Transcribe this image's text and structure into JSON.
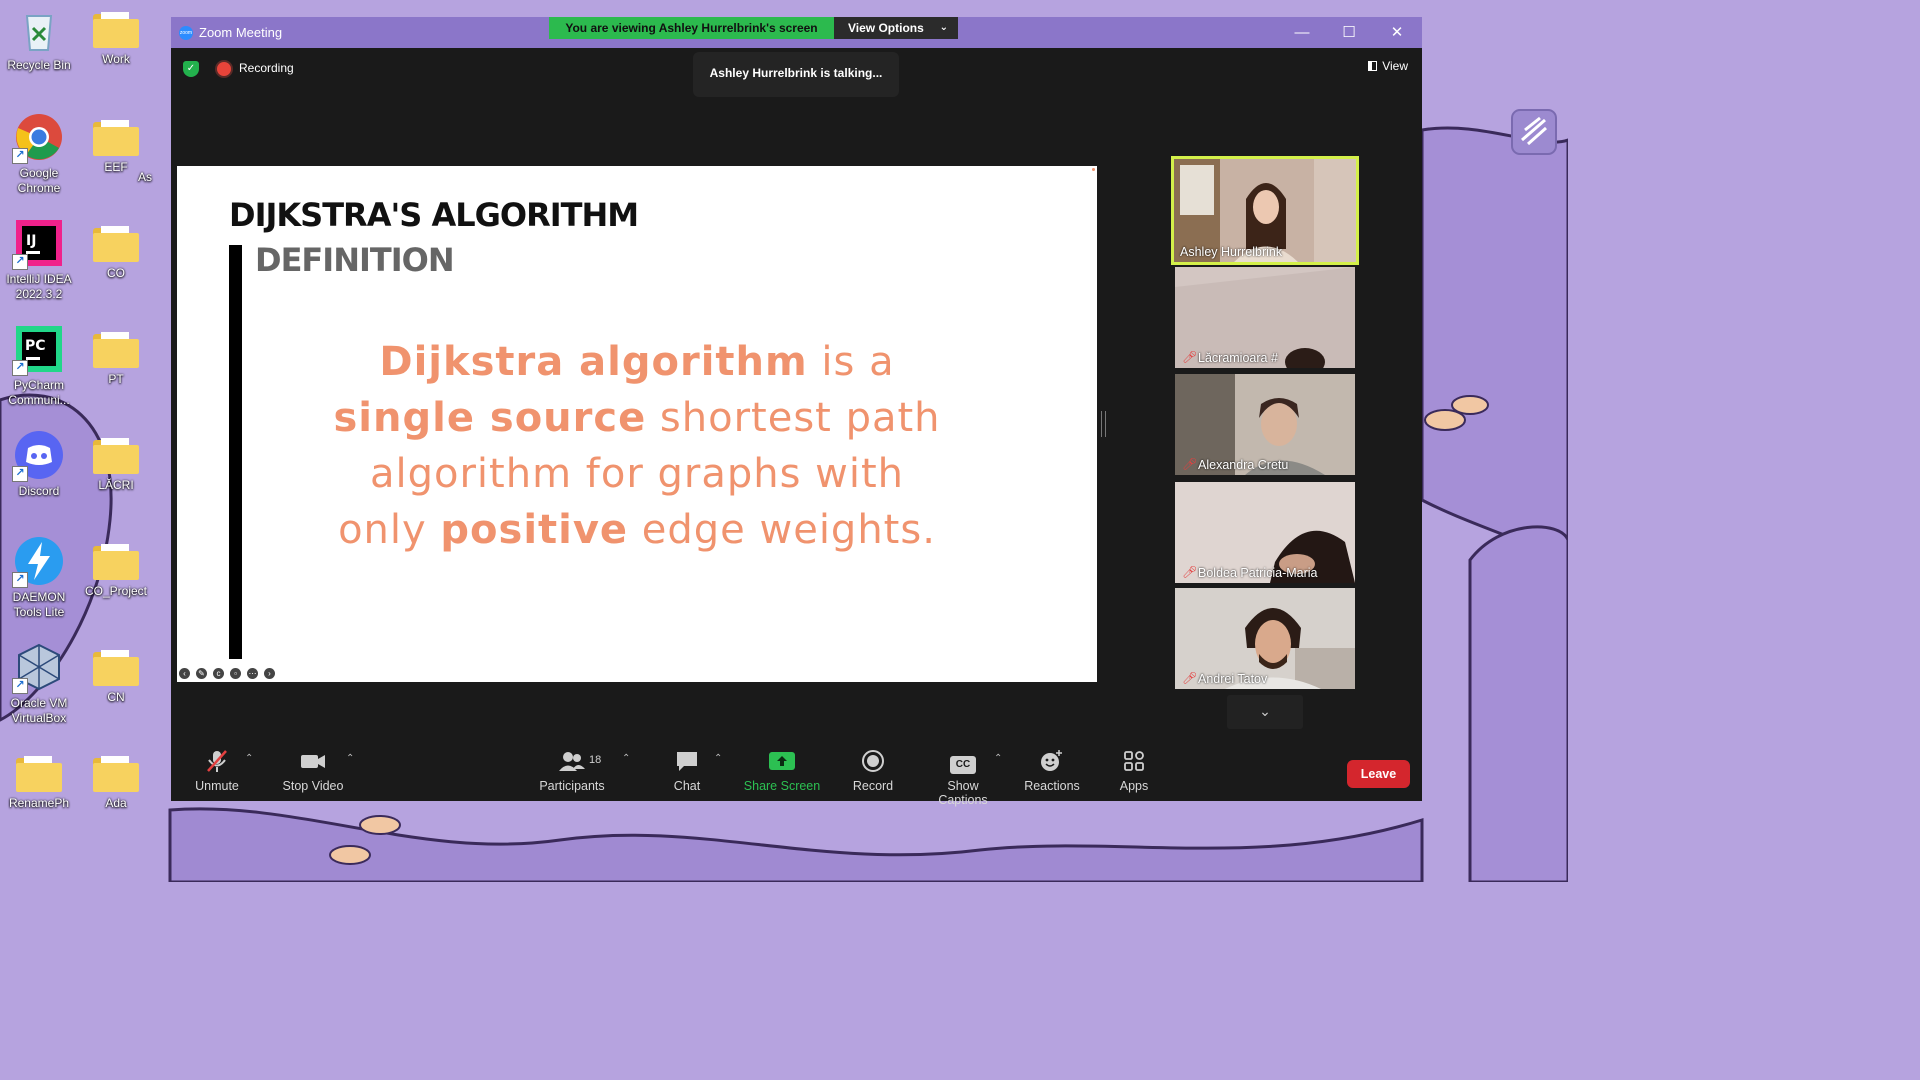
{
  "desktop": {
    "icons": [
      {
        "label": "Recycle Bin",
        "icon": "recycle-bin-icon"
      },
      {
        "label": "Work",
        "icon": "folder-icon"
      },
      {
        "label": "Google Chrome",
        "icon": "chrome-icon"
      },
      {
        "label": "EEF",
        "icon": "folder-icon"
      },
      {
        "label": "IntelliJ IDEA 2022.3.2",
        "icon": "intellij-icon"
      },
      {
        "label": "CO",
        "icon": "folder-icon"
      },
      {
        "label": "PyCharm Communi...",
        "icon": "pycharm-icon"
      },
      {
        "label": "PT",
        "icon": "folder-icon"
      },
      {
        "label": "Discord",
        "icon": "discord-icon"
      },
      {
        "label": "LĂCRI",
        "icon": "folder-icon"
      },
      {
        "label": "DAEMON Tools Lite",
        "icon": "daemon-tools-icon"
      },
      {
        "label": "CO_Project",
        "icon": "folder-icon"
      },
      {
        "label": "Oracle VM VirtualBox",
        "icon": "virtualbox-icon"
      },
      {
        "label": "CN",
        "icon": "folder-icon"
      },
      {
        "label": "RenamePh",
        "icon": "folder-icon"
      },
      {
        "label": "Ada",
        "icon": "folder-icon"
      }
    ],
    "partial_label": "As"
  },
  "window": {
    "title": "Zoom Meeting",
    "minimize": "—",
    "maximize": "☐",
    "close": "✕"
  },
  "share_banner": {
    "text": "You are viewing Ashley Hurrelbrink's screen",
    "options_label": "View Options"
  },
  "status": {
    "recording_label": "Recording",
    "talking": "Ashley Hurrelbrink is talking...",
    "view_label": "View"
  },
  "slide": {
    "title": "DIJKSTRA'S ALGORITHM",
    "subtitle": "DEFINITION",
    "body": {
      "line1_bold": "Dijkstra algorithm",
      "line1_rest": " is a",
      "line2_bold": "single source",
      "line2_rest": " shortest path",
      "line3": "algorithm for graphs with",
      "line4_start": "only ",
      "line4_bold": "positive",
      "line4_rest": " edge weights."
    }
  },
  "participants": [
    {
      "name": "Ashley Hurrelbrink",
      "muted": false,
      "active": true
    },
    {
      "name": "Lăcramioara #",
      "muted": true,
      "active": false
    },
    {
      "name": "Alexandra Cretu",
      "muted": true,
      "active": false
    },
    {
      "name": "Boldea Patricia-Maria",
      "muted": true,
      "active": false
    },
    {
      "name": "Andrei Tatov",
      "muted": true,
      "active": false
    }
  ],
  "toolbar": {
    "unmute": "Unmute",
    "stop_video": "Stop Video",
    "participants": "Participants",
    "participants_count": "18",
    "chat": "Chat",
    "share_screen": "Share Screen",
    "record": "Record",
    "show_captions": "Show Captions",
    "captions_icon_text": "CC",
    "reactions": "Reactions",
    "apps": "Apps",
    "leave": "Leave"
  },
  "colors": {
    "window_titlebar": "#8b76c9",
    "banner_green": "#2cba4e",
    "slide_accent": "#f0936e",
    "leave_red": "#d4262d",
    "active_speaker_border": "#d4f04a"
  }
}
